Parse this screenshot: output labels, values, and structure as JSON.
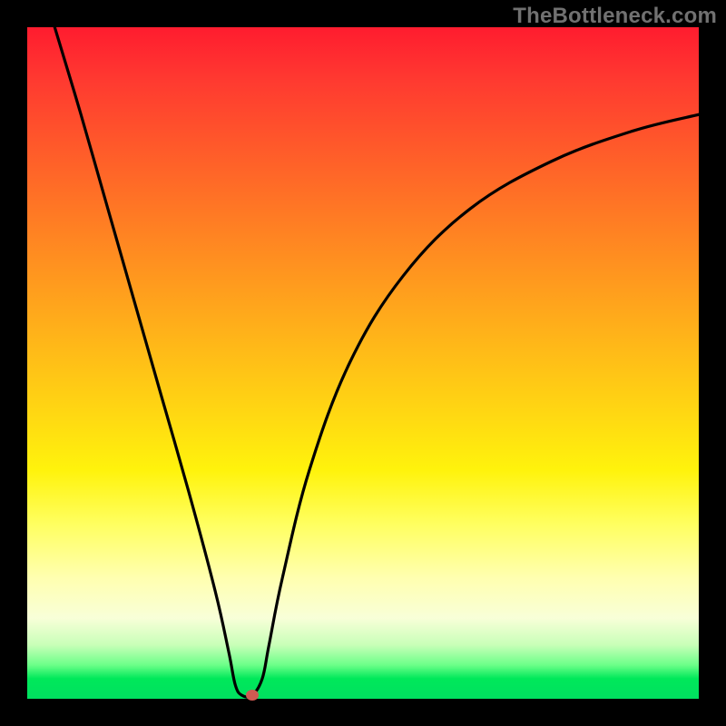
{
  "watermark": "TheBottleneck.com",
  "colors": {
    "frame": "#000000",
    "watermark_text": "#717171",
    "curve": "#000000",
    "marker": "#d15a52",
    "gradient_stops": [
      "#ff1c2f",
      "#ff3a30",
      "#ff5a2a",
      "#ff7a24",
      "#ff9a1e",
      "#ffba18",
      "#ffd912",
      "#fff30c",
      "#ffff60",
      "#ffffb0",
      "#f8ffd8",
      "#c8ffb8",
      "#6bff88",
      "#00e85a",
      "#00e060"
    ]
  },
  "chart_data": {
    "type": "line",
    "title": "",
    "xlabel": "",
    "ylabel": "",
    "xlim": [
      0,
      100
    ],
    "ylim": [
      0,
      100
    ],
    "grid": false,
    "legend": false,
    "series": [
      {
        "name": "bottleneck-curve",
        "x": [
          4.1,
          8,
          12,
          16,
          20,
          24,
          28,
          30,
          31,
          32,
          33.5,
          35,
          36,
          38,
          42,
          48,
          56,
          66,
          78,
          90,
          100
        ],
        "y": [
          100,
          87,
          73,
          59,
          45,
          31,
          16,
          7,
          2,
          0.5,
          0.5,
          3,
          8,
          18,
          34,
          50,
          63,
          73,
          80,
          84.5,
          87
        ]
      }
    ],
    "annotations": [
      {
        "name": "minimum-marker",
        "x": 33.5,
        "y": 0.5
      }
    ]
  }
}
